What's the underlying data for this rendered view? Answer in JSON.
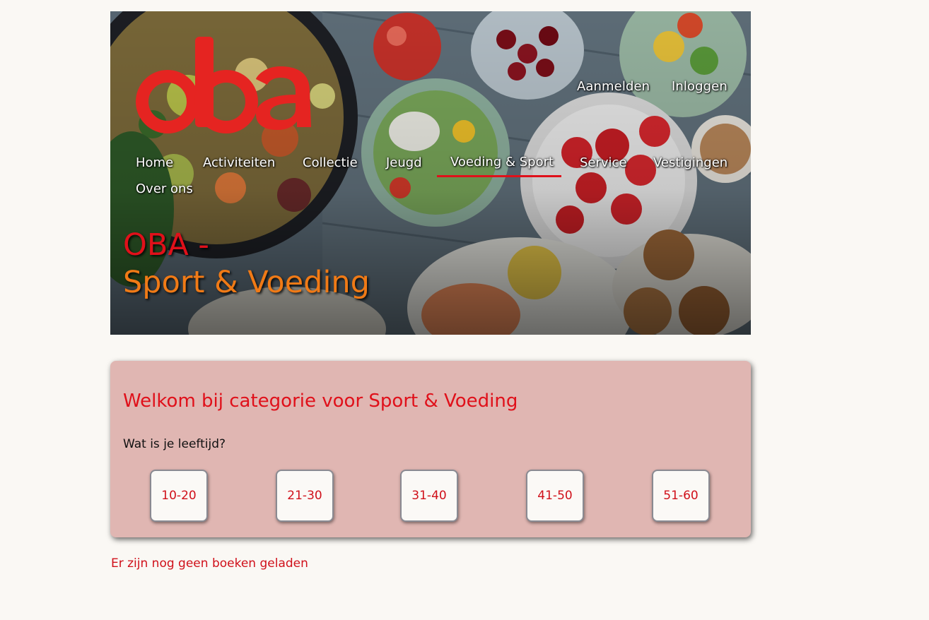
{
  "brand": {
    "logo_text": "oba",
    "logo_color": "#e52421"
  },
  "account": {
    "register_label": "Aanmelden",
    "login_label": "Inloggen"
  },
  "nav": {
    "items": [
      {
        "label": "Home"
      },
      {
        "label": "Activiteiten"
      },
      {
        "label": "Collectie"
      },
      {
        "label": "Jeugd"
      },
      {
        "label": "Voeding & Sport",
        "active": true
      },
      {
        "label": "Service"
      },
      {
        "label": "Vestigingen"
      },
      {
        "label": "Over ons"
      }
    ]
  },
  "hero": {
    "title_line1": "OBA -",
    "title_line2": "Sport & Voeding"
  },
  "card": {
    "title": "Welkom bij categorie voor Sport & Voeding",
    "question": "Wat is je leeftijd?",
    "age_options": [
      "10-20",
      "21-30",
      "31-40",
      "41-50",
      "51-60"
    ]
  },
  "status": {
    "message": "Er zijn nog geen boeken geladen"
  },
  "colors": {
    "accent_red": "#e0101a",
    "accent_orange": "#f07a16",
    "card_background": "#e0b6b2",
    "page_background": "#faf8f4"
  }
}
